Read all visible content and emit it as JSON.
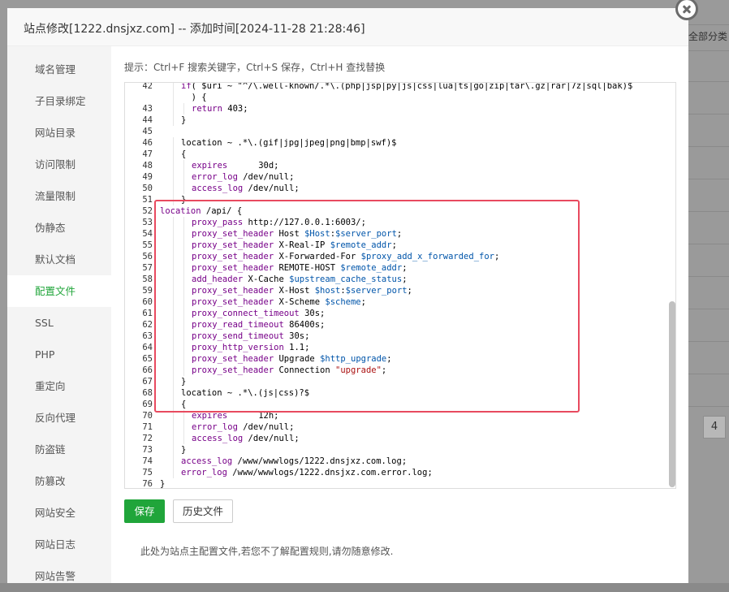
{
  "modal": {
    "title": "站点修改[1222.dnsjxz.com] -- 添加时间[2024-11-28 21:28:46]",
    "tip": "提示：Ctrl+F 搜索关键字，Ctrl+S 保存，Ctrl+H 查找替换",
    "note": "此处为站点主配置文件,若您不了解配置规则,请勿随意修改.",
    "save_label": "保存",
    "history_label": "历史文件",
    "close_icon": "close-icon"
  },
  "background": {
    "category_label": "全部分类",
    "page_number": "4"
  },
  "sidebar": {
    "active_index": 7,
    "items": [
      {
        "label": "域名管理"
      },
      {
        "label": "子目录绑定"
      },
      {
        "label": "网站目录"
      },
      {
        "label": "访问限制"
      },
      {
        "label": "流量限制"
      },
      {
        "label": "伪静态"
      },
      {
        "label": "默认文档"
      },
      {
        "label": "配置文件"
      },
      {
        "label": "SSL"
      },
      {
        "label": "PHP"
      },
      {
        "label": "重定向"
      },
      {
        "label": "反向代理"
      },
      {
        "label": "防盗链"
      },
      {
        "label": "防篡改"
      },
      {
        "label": "网站安全"
      },
      {
        "label": "网站日志"
      },
      {
        "label": "网站告警"
      }
    ]
  },
  "editor": {
    "accent_color": "#20a53a",
    "highlight_color": "#e84a5f",
    "lines": [
      {
        "n": "42",
        "indent": 2,
        "tokens": [
          [
            "kw",
            "if"
          ],
          [
            "",
            "( $uri ~ \"^/\\.well-known/.*\\.(php|jsp|py|js|css|lua|ts|go|zip|tar\\.gz|rar|7z|sql|bak)$"
          ]
        ]
      },
      {
        "n": "",
        "indent": 2,
        "tokens": [
          [
            "",
            "  ) {"
          ]
        ]
      },
      {
        "n": "43",
        "indent": 3,
        "tokens": [
          [
            "kw",
            "return"
          ],
          [
            "",
            " 403;"
          ]
        ]
      },
      {
        "n": "44",
        "indent": 2,
        "tokens": [
          [
            "",
            "}"
          ]
        ]
      },
      {
        "n": "45",
        "indent": 0,
        "tokens": []
      },
      {
        "n": "46",
        "indent": 2,
        "tokens": [
          [
            "",
            "location ~ .*\\.(gif|jpg|jpeg|png|bmp|swf)$"
          ]
        ]
      },
      {
        "n": "47",
        "indent": 2,
        "tokens": [
          [
            "",
            "{"
          ]
        ]
      },
      {
        "n": "48",
        "indent": 3,
        "tokens": [
          [
            "kw",
            "expires"
          ],
          [
            "",
            "      30d;"
          ]
        ]
      },
      {
        "n": "49",
        "indent": 3,
        "tokens": [
          [
            "kw",
            "error_log"
          ],
          [
            "",
            " /dev/null;"
          ]
        ]
      },
      {
        "n": "50",
        "indent": 3,
        "tokens": [
          [
            "kw",
            "access_log"
          ],
          [
            "",
            " /dev/null;"
          ]
        ]
      },
      {
        "n": "51",
        "indent": 2,
        "tokens": [
          [
            "",
            "}"
          ]
        ]
      },
      {
        "n": "52",
        "indent": 0,
        "tokens": [
          [
            "kw",
            "location"
          ],
          [
            "",
            " /api/ {"
          ]
        ]
      },
      {
        "n": "53",
        "indent": 3,
        "tokens": [
          [
            "kw",
            "proxy_pass"
          ],
          [
            "",
            " http://127.0.0.1:6003/;"
          ]
        ]
      },
      {
        "n": "54",
        "indent": 3,
        "tokens": [
          [
            "kw",
            "proxy_set_header"
          ],
          [
            "",
            " Host "
          ],
          [
            "var",
            "$Host"
          ],
          [
            "",
            ":"
          ],
          [
            "var",
            "$server_port"
          ],
          [
            "",
            ";"
          ]
        ]
      },
      {
        "n": "55",
        "indent": 3,
        "tokens": [
          [
            "kw",
            "proxy_set_header"
          ],
          [
            "",
            " X-Real-IP "
          ],
          [
            "var",
            "$remote_addr"
          ],
          [
            "",
            ";"
          ]
        ]
      },
      {
        "n": "56",
        "indent": 3,
        "tokens": [
          [
            "kw",
            "proxy_set_header"
          ],
          [
            "",
            " X-Forwarded-For "
          ],
          [
            "var",
            "$proxy_add_x_forwarded_for"
          ],
          [
            "",
            ";"
          ]
        ]
      },
      {
        "n": "57",
        "indent": 3,
        "tokens": [
          [
            "kw",
            "proxy_set_header"
          ],
          [
            "",
            " REMOTE-HOST "
          ],
          [
            "var",
            "$remote_addr"
          ],
          [
            "",
            ";"
          ]
        ]
      },
      {
        "n": "58",
        "indent": 3,
        "tokens": [
          [
            "kw",
            "add_header"
          ],
          [
            "",
            " X-Cache "
          ],
          [
            "var",
            "$upstream_cache_status"
          ],
          [
            "",
            ";"
          ]
        ]
      },
      {
        "n": "59",
        "indent": 3,
        "tokens": [
          [
            "kw",
            "proxy_set_header"
          ],
          [
            "",
            " X-Host "
          ],
          [
            "var",
            "$host"
          ],
          [
            "",
            ":"
          ],
          [
            "var",
            "$server_port"
          ],
          [
            "",
            ";"
          ]
        ]
      },
      {
        "n": "60",
        "indent": 3,
        "tokens": [
          [
            "kw",
            "proxy_set_header"
          ],
          [
            "",
            " X-Scheme "
          ],
          [
            "var",
            "$scheme"
          ],
          [
            "",
            ";"
          ]
        ]
      },
      {
        "n": "61",
        "indent": 3,
        "tokens": [
          [
            "kw",
            "proxy_connect_timeout"
          ],
          [
            "",
            " 30s;"
          ]
        ]
      },
      {
        "n": "62",
        "indent": 3,
        "tokens": [
          [
            "kw",
            "proxy_read_timeout"
          ],
          [
            "",
            " 86400s;"
          ]
        ]
      },
      {
        "n": "63",
        "indent": 3,
        "tokens": [
          [
            "kw",
            "proxy_send_timeout"
          ],
          [
            "",
            " 30s;"
          ]
        ]
      },
      {
        "n": "64",
        "indent": 3,
        "tokens": [
          [
            "kw",
            "proxy_http_version"
          ],
          [
            "",
            " 1.1;"
          ]
        ]
      },
      {
        "n": "65",
        "indent": 3,
        "tokens": [
          [
            "kw",
            "proxy_set_header"
          ],
          [
            "",
            " Upgrade "
          ],
          [
            "var",
            "$http_upgrade"
          ],
          [
            "",
            ";"
          ]
        ]
      },
      {
        "n": "66",
        "indent": 3,
        "tokens": [
          [
            "kw",
            "proxy_set_header"
          ],
          [
            "",
            " Connection "
          ],
          [
            "str",
            "\"upgrade\""
          ],
          [
            "",
            ";"
          ]
        ]
      },
      {
        "n": "67",
        "indent": 2,
        "tokens": [
          [
            "",
            "}"
          ]
        ]
      },
      {
        "n": "68",
        "indent": 2,
        "tokens": [
          [
            "",
            "location ~ .*\\.(js|css)?$"
          ]
        ]
      },
      {
        "n": "69",
        "indent": 2,
        "tokens": [
          [
            "",
            "{"
          ]
        ]
      },
      {
        "n": "70",
        "indent": 3,
        "tokens": [
          [
            "kw",
            "expires"
          ],
          [
            "",
            "      12h;"
          ]
        ]
      },
      {
        "n": "71",
        "indent": 3,
        "tokens": [
          [
            "kw",
            "error_log"
          ],
          [
            "",
            " /dev/null;"
          ]
        ]
      },
      {
        "n": "72",
        "indent": 3,
        "tokens": [
          [
            "kw",
            "access_log"
          ],
          [
            "",
            " /dev/null;"
          ]
        ]
      },
      {
        "n": "73",
        "indent": 2,
        "tokens": [
          [
            "",
            "}"
          ]
        ]
      },
      {
        "n": "74",
        "indent": 2,
        "tokens": [
          [
            "kw",
            "access_log"
          ],
          [
            "",
            " /www/wwwlogs/1222.dnsjxz.com.log;"
          ]
        ]
      },
      {
        "n": "75",
        "indent": 2,
        "tokens": [
          [
            "kw",
            "error_log"
          ],
          [
            "",
            " /www/wwwlogs/1222.dnsjxz.com.error.log;"
          ]
        ]
      },
      {
        "n": "76",
        "indent": 0,
        "tokens": [
          [
            "",
            "}"
          ]
        ]
      }
    ]
  }
}
